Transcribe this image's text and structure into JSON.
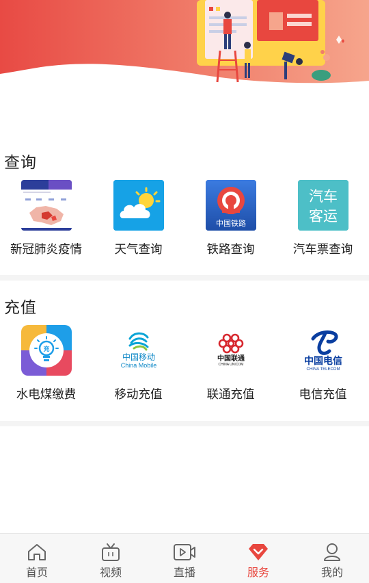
{
  "sections": [
    {
      "title": "查询",
      "items": [
        {
          "label": "新冠肺炎疫情",
          "icon": "covid-map-icon"
        },
        {
          "label": "天气查询",
          "icon": "weather-icon"
        },
        {
          "label": "铁路查询",
          "icon": "railway-icon",
          "icon_text": "中国铁路"
        },
        {
          "label": "汽车票查询",
          "icon": "bus-ticket-icon",
          "icon_text": [
            "汽车",
            "客运"
          ]
        }
      ]
    },
    {
      "title": "充值",
      "items": [
        {
          "label": "水电煤缴费",
          "icon": "utility-bill-icon",
          "icon_text": "充"
        },
        {
          "label": "移动充值",
          "icon": "china-mobile-icon",
          "icon_text": [
            "中国移动",
            "China Mobile"
          ]
        },
        {
          "label": "联通充值",
          "icon": "china-unicom-icon",
          "icon_text": [
            "中国联通",
            "CHINA UNICOM"
          ]
        },
        {
          "label": "电信充值",
          "icon": "china-telecom-icon",
          "icon_text": [
            "中国电信",
            "CHINA TELECOM"
          ]
        }
      ]
    }
  ],
  "tabbar": {
    "items": [
      {
        "label": "首页",
        "icon": "home-icon",
        "active": false
      },
      {
        "label": "视频",
        "icon": "tv-icon",
        "active": false
      },
      {
        "label": "直播",
        "icon": "live-video-icon",
        "active": false
      },
      {
        "label": "服务",
        "icon": "heart-diamond-icon",
        "active": true
      },
      {
        "label": "我的",
        "icon": "profile-icon",
        "active": false
      }
    ]
  },
  "colors": {
    "accent": "#e8473f",
    "banner_start": "#e84a44",
    "banner_end": "#f6a58c",
    "divider": "#f4f4f4",
    "tabbar_bg": "#f7f7f7"
  }
}
